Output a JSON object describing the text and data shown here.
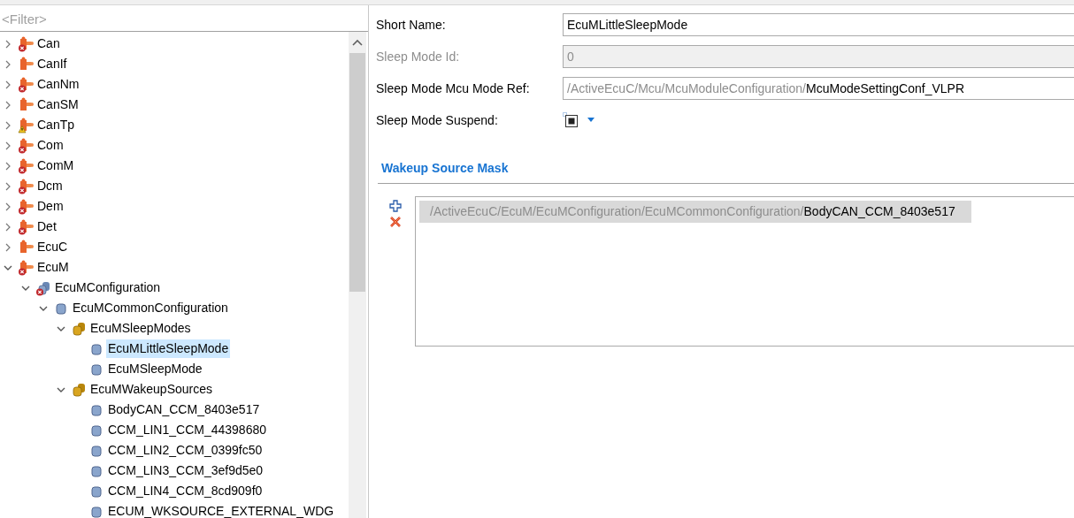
{
  "filter": {
    "placeholder": "<Filter>"
  },
  "tree": [
    {
      "label": "Can",
      "kind": "module",
      "error": true,
      "warning": false,
      "expanded": false,
      "selected": false
    },
    {
      "label": "CanIf",
      "kind": "module",
      "error": false,
      "warning": false,
      "expanded": false,
      "selected": false
    },
    {
      "label": "CanNm",
      "kind": "module",
      "error": true,
      "warning": false,
      "expanded": false,
      "selected": false
    },
    {
      "label": "CanSM",
      "kind": "module",
      "error": false,
      "warning": false,
      "expanded": false,
      "selected": false
    },
    {
      "label": "CanTp",
      "kind": "module",
      "error": false,
      "warning": true,
      "expanded": false,
      "selected": false
    },
    {
      "label": "Com",
      "kind": "module",
      "error": true,
      "warning": false,
      "expanded": false,
      "selected": false
    },
    {
      "label": "ComM",
      "kind": "module",
      "error": true,
      "warning": false,
      "expanded": false,
      "selected": false
    },
    {
      "label": "Dcm",
      "kind": "module",
      "error": true,
      "warning": false,
      "expanded": false,
      "selected": false
    },
    {
      "label": "Dem",
      "kind": "module",
      "error": true,
      "warning": false,
      "expanded": false,
      "selected": false
    },
    {
      "label": "Det",
      "kind": "module",
      "error": true,
      "warning": false,
      "expanded": false,
      "selected": false
    },
    {
      "label": "EcuC",
      "kind": "module",
      "error": false,
      "warning": false,
      "expanded": false,
      "selected": false
    },
    {
      "label": "EcuM",
      "kind": "module",
      "error": true,
      "warning": false,
      "expanded": true,
      "selected": false,
      "children": [
        {
          "label": "EcuMConfiguration",
          "kind": "containers",
          "error": true,
          "warning": false,
          "expanded": true,
          "selected": false,
          "children": [
            {
              "label": "EcuMCommonConfiguration",
              "kind": "container",
              "error": false,
              "warning": false,
              "expanded": true,
              "selected": false,
              "children": [
                {
                  "label": "EcuMSleepModes",
                  "kind": "list",
                  "error": false,
                  "warning": false,
                  "expanded": true,
                  "selected": false,
                  "children": [
                    {
                      "label": "EcuMLittleSleepMode",
                      "kind": "container",
                      "error": false,
                      "warning": false,
                      "selected": true
                    },
                    {
                      "label": "EcuMSleepMode",
                      "kind": "container",
                      "error": false,
                      "warning": false,
                      "selected": false
                    }
                  ]
                },
                {
                  "label": "EcuMWakeupSources",
                  "kind": "list",
                  "error": false,
                  "warning": false,
                  "expanded": true,
                  "selected": false,
                  "children": [
                    {
                      "label": "BodyCAN_CCM_8403e517",
                      "kind": "container",
                      "error": false,
                      "warning": false,
                      "selected": false
                    },
                    {
                      "label": "CCM_LIN1_CCM_44398680",
                      "kind": "container",
                      "error": false,
                      "warning": false,
                      "selected": false
                    },
                    {
                      "label": "CCM_LIN2_CCM_0399fc50",
                      "kind": "container",
                      "error": false,
                      "warning": false,
                      "selected": false
                    },
                    {
                      "label": "CCM_LIN3_CCM_3ef9d5e0",
                      "kind": "container",
                      "error": false,
                      "warning": false,
                      "selected": false
                    },
                    {
                      "label": "CCM_LIN4_CCM_8cd909f0",
                      "kind": "container",
                      "error": false,
                      "warning": false,
                      "selected": false
                    },
                    {
                      "label": "ECUM_WKSOURCE_EXTERNAL_WDG",
                      "kind": "container",
                      "error": false,
                      "warning": false,
                      "selected": false
                    }
                  ]
                }
              ]
            }
          ]
        }
      ]
    }
  ],
  "fields": [
    {
      "kind": "text",
      "label": "Short Name:",
      "value": "EcuMLittleSleepMode",
      "disabled": false
    },
    {
      "kind": "text",
      "label": "Sleep Mode Id:",
      "value": "0",
      "disabled": true
    },
    {
      "kind": "reference",
      "label": "Sleep Mode Mcu Mode Ref:",
      "path": "/ActiveEcuC/Mcu/McuModuleConfiguration/",
      "target": "McuModeSettingConf_VLPR",
      "disabled": false
    },
    {
      "kind": "checkbox",
      "label": "Sleep Mode Suspend:",
      "checked": true,
      "disabled": false
    }
  ],
  "wakeup_source_mask": {
    "title": "Wakeup Source Mask",
    "items": [
      {
        "path": "/ActiveEcuC/EcuM/EcuMConfiguration/EcuMCommonConfiguration/",
        "target": "BodyCAN_CCM_8403e517",
        "selected": true
      }
    ]
  }
}
